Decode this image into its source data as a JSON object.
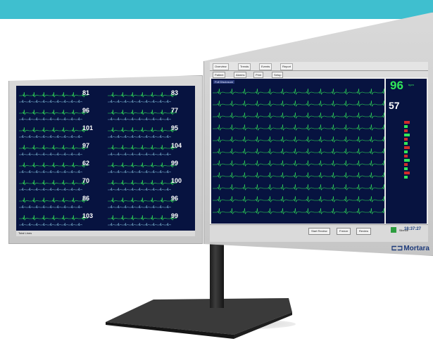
{
  "colors": {
    "banner": "#3fbfcf",
    "screen_bg": "#071340",
    "trace": "#31e85a",
    "bezel": "#d0d0d0",
    "brand": "#1d3a7a"
  },
  "brand": {
    "logo_icon": "mortara-logo-icon",
    "name": "Mortara"
  },
  "left_monitor": {
    "status_label": "Total Lines",
    "beds": [
      {
        "hr": "81"
      },
      {
        "hr": "96"
      },
      {
        "hr": "101"
      },
      {
        "hr": "97"
      },
      {
        "hr": "62"
      },
      {
        "hr": "70"
      },
      {
        "hr": "86"
      },
      {
        "hr": "103"
      }
    ],
    "right_column": [
      {
        "hr": "83"
      },
      {
        "hr": "77"
      },
      {
        "hr": "95"
      },
      {
        "hr": "104"
      },
      {
        "hr": "99"
      },
      {
        "hr": "100"
      },
      {
        "hr": "96"
      },
      {
        "hr": "99"
      }
    ]
  },
  "right_monitor": {
    "tabs": [
      "Overview",
      "Trends",
      "Events",
      "Report"
    ],
    "toolbar": [
      "Patient",
      "Alarms",
      "Print",
      "Setup"
    ],
    "ecg_title": "Full Disclosure",
    "vitals": {
      "hr": "96",
      "hr_unit": "bpm",
      "spo2": "57"
    },
    "bottom_buttons": [
      "Start Review",
      "Freeze",
      "Review"
    ],
    "alarm_label": "Silence",
    "clock": "18:37:27"
  }
}
